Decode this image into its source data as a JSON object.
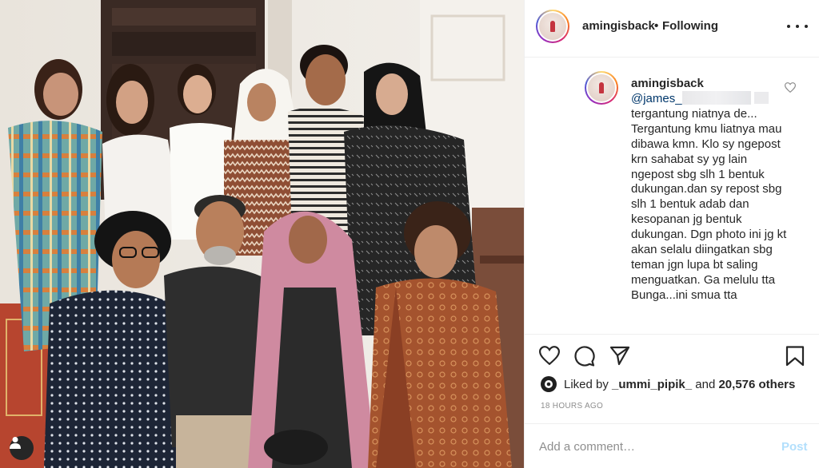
{
  "post": {
    "author": "amingisback",
    "separator": "•",
    "follow_status": "Following",
    "photo_alt": "Group photo of eleven friends in a hallway",
    "user_tag_icon": "user-icon"
  },
  "caption": {
    "username": "amingisback",
    "mention": "@james_",
    "text": "tergantung niatnya de... Tergantung kmu liatnya mau dibawa kmn. Klo sy ngepost krn sahabat sy yg lain ngepost sbg slh 1 bentuk dukungan.dan sy repost sbg slh 1 bentuk adab dan kesopanan jg bentuk dukungan. Dgn photo ini jg kt akan selalu diingatkan sbg teman jgn lupa bt saling menguatkan. Ga melulu tta Bunga...ini smua tta"
  },
  "actions": {
    "icons": [
      "heart-icon",
      "comment-icon",
      "share-icon",
      "bookmark-icon"
    ]
  },
  "likes": {
    "prefix": "Liked by",
    "user": "_ummi_pipik_",
    "joiner": "and",
    "others": "20,576 others"
  },
  "timestamp": "18 HOURS AGO",
  "comment_box": {
    "placeholder": "Add a comment…",
    "post_label": "Post"
  },
  "colors": {
    "text": "#262626",
    "muted": "#8e8e8e",
    "link": "#00376b",
    "post_disabled": "#b2dffc",
    "border": "#efefef"
  }
}
